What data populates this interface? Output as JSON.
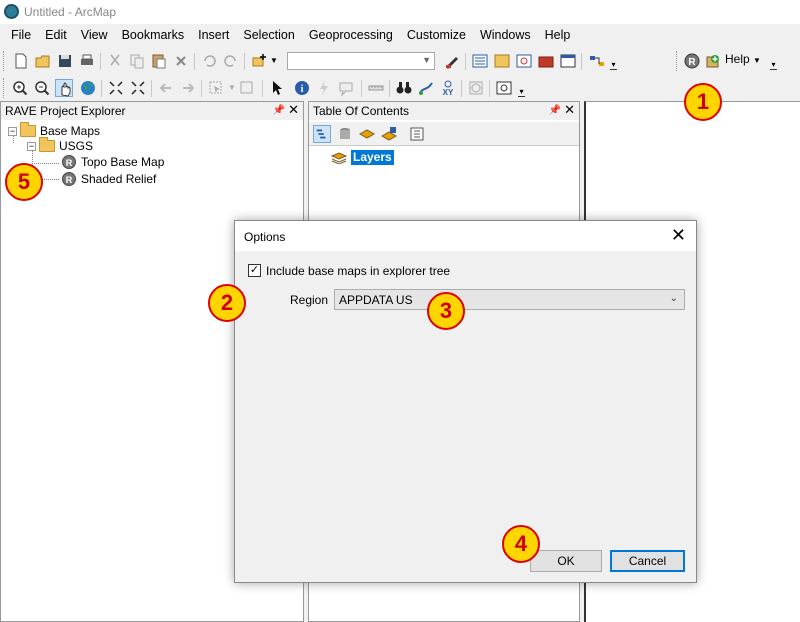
{
  "window": {
    "title": "Untitled - ArcMap"
  },
  "menu": [
    "File",
    "Edit",
    "View",
    "Bookmarks",
    "Insert",
    "Selection",
    "Geoprocessing",
    "Customize",
    "Windows",
    "Help"
  ],
  "toolbar": {
    "help_label": "Help"
  },
  "rave_panel": {
    "title": "RAVE Project Explorer",
    "tree": {
      "root": "Base Maps",
      "folder": "USGS",
      "items": [
        "Topo Base Map",
        "Shaded Relief"
      ]
    }
  },
  "toc_panel": {
    "title": "Table Of Contents",
    "layers_label": "Layers"
  },
  "dialog": {
    "title": "Options",
    "checkbox_label": "Include base maps in explorer tree",
    "checkbox_checked": true,
    "region_label": "Region",
    "region_value": "APPDATA US",
    "ok_label": "OK",
    "cancel_label": "Cancel"
  },
  "callouts": [
    "1",
    "2",
    "3",
    "4",
    "5"
  ],
  "colors": {
    "callout_fill": "#ffd500",
    "callout_border": "#e00000",
    "selection": "#0078d7"
  }
}
